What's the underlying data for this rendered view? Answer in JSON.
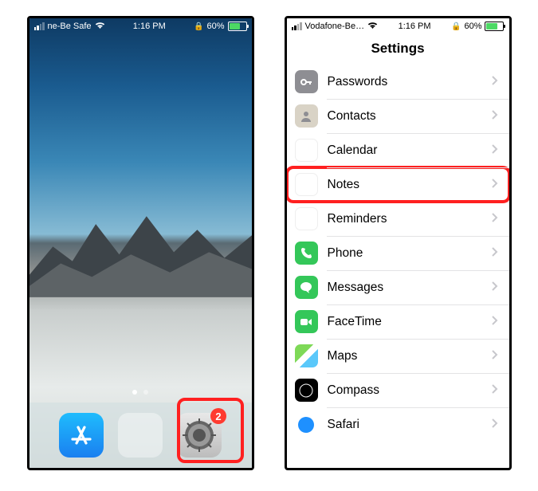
{
  "status": {
    "left_carrier": "ne-Be Safe",
    "right_carrier": "Vodafone-Be…",
    "time": "1:16 PM",
    "battery_pct": "60%"
  },
  "home": {
    "settings_badge": "2"
  },
  "settings": {
    "title": "Settings",
    "items": [
      {
        "id": "passwords",
        "label": "Passwords",
        "bg": "#8e8e93",
        "glyph": "key"
      },
      {
        "id": "contacts",
        "label": "Contacts",
        "bg": "#d9d3c6",
        "glyph": "contact"
      },
      {
        "id": "calendar",
        "label": "Calendar",
        "bg": "cal",
        "glyph": "cal"
      },
      {
        "id": "notes",
        "label": "Notes",
        "bg": "notes",
        "glyph": "notes",
        "highlight": true
      },
      {
        "id": "reminders",
        "label": "Reminders",
        "bg": "rem",
        "glyph": "rem"
      },
      {
        "id": "phone",
        "label": "Phone",
        "bg": "#34c759",
        "glyph": "phone"
      },
      {
        "id": "messages",
        "label": "Messages",
        "bg": "#34c759",
        "glyph": "msg"
      },
      {
        "id": "facetime",
        "label": "FaceTime",
        "bg": "#34c759",
        "glyph": "video"
      },
      {
        "id": "maps",
        "label": "Maps",
        "bg": "maps",
        "glyph": "maps"
      },
      {
        "id": "compass",
        "label": "Compass",
        "bg": "#000",
        "glyph": "compass"
      },
      {
        "id": "safari",
        "label": "Safari",
        "bg": "safari",
        "glyph": "safari"
      }
    ]
  }
}
